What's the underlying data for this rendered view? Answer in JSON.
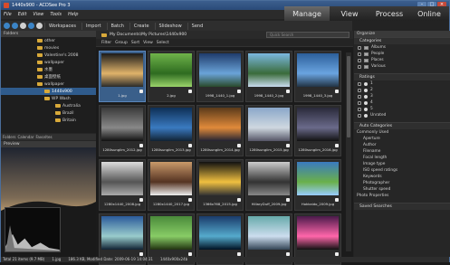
{
  "window": {
    "title": "1440x900 - ACDSee Pro 3"
  },
  "menu": [
    "File",
    "Edit",
    "View",
    "Tools",
    "Help"
  ],
  "modes": [
    "Manage",
    "View",
    "Process",
    "Online"
  ],
  "toolbar": {
    "items": [
      "Workspaces",
      "Import",
      "Batch",
      "Create",
      "Slideshow",
      "Send"
    ]
  },
  "folders": {
    "header": "Folders",
    "items": [
      "other",
      "movies",
      "Valentine's 2008",
      "wallpaper",
      "水墨",
      "桌面壁纸",
      "wallpaper",
      "1440x900",
      "WP Wash",
      "Australia",
      "Brazil",
      "Britain"
    ]
  },
  "left_tabs": [
    "Folders",
    "Calendar",
    "Favorites"
  ],
  "preview": {
    "header": "Preview"
  },
  "path": "My Documents\\My Pictures\\1440x900",
  "search_placeholder": "Quick Search",
  "filters": [
    "Filter",
    "Group",
    "Sort",
    "View",
    "Select"
  ],
  "thumbnails": [
    {
      "caption": "1.jpg"
    },
    {
      "caption": "2.jpg"
    },
    {
      "caption": "1998_1440_1.jpg"
    },
    {
      "caption": "1998_1440_2.jpg"
    },
    {
      "caption": "1998_1440_3.jpg"
    },
    {
      "caption": "1280sunglim_2012.jpg"
    },
    {
      "caption": "1280sunglim_2013.jpg"
    },
    {
      "caption": "1280sunglim_2014.jpg"
    },
    {
      "caption": "1280sunglim_2015.jpg"
    },
    {
      "caption": "1280sunglim_2016.jpg"
    },
    {
      "caption": "1280x1440_2008.jpg"
    },
    {
      "caption": "1280x1440_2017.jpg"
    },
    {
      "caption": "1366x768_2015.jpg"
    },
    {
      "caption": "HillaryDuff_2009.jpg"
    },
    {
      "caption": "Hokkaido_2009.jpg"
    },
    {
      "caption": ""
    },
    {
      "caption": ""
    },
    {
      "caption": ""
    },
    {
      "caption": ""
    },
    {
      "caption": ""
    }
  ],
  "organize": {
    "header": "Organize",
    "categories_title": "Categories",
    "categories": [
      "Albums",
      "People",
      "Places",
      "Various"
    ],
    "ratings_title": "Ratings",
    "ratings": [
      "1",
      "2",
      "3",
      "4",
      "5",
      "Unrated"
    ],
    "auto_categories_title": "Auto Categories",
    "common_title": "Commonly Used",
    "common": [
      "Aperture",
      "Author",
      "Filename",
      "Focal length",
      "Image type",
      "ISO speed ratings",
      "Keywords",
      "Photographer",
      "Shutter speed",
      "Photo Properties"
    ],
    "saved_title": "Saved Searches"
  },
  "status": [
    "Total 21 items (9.7 MB)",
    "1.jpg",
    "186.3 KB, Modified Date: 2009-06-19 14:04:31",
    "1440x900x24b"
  ]
}
